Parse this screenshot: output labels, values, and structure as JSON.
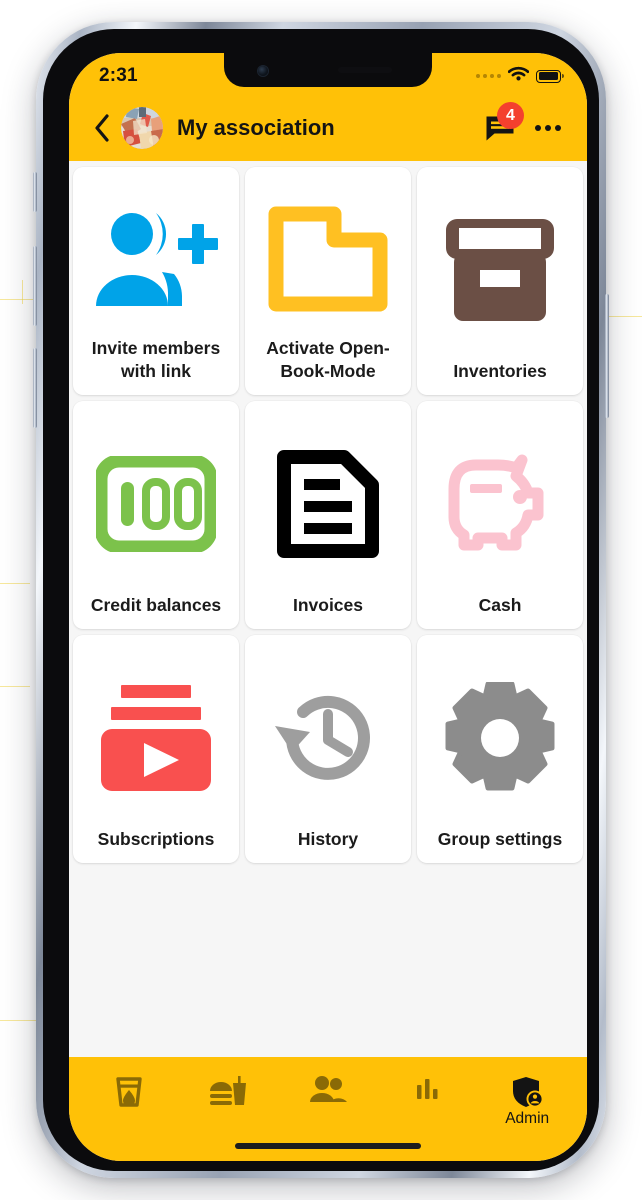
{
  "colors": {
    "brand_yellow": "#FFC107",
    "badge_red": "#F4402E",
    "content_bg": "#f6f6f6",
    "tile_bg": "#ffffff",
    "invite_blue": "#00A3E8",
    "openbook_yellow": "#FFC022",
    "inventories_brown": "#6B4F45",
    "credit_green": "#7CC24B",
    "invoices_black": "#000000",
    "cash_pink": "#FBC3CF",
    "subscriptions_red": "#F9504F",
    "history_gray": "#9E9E9E",
    "settings_gray": "#8C8C8C",
    "nav_icon": "#8A6A06"
  },
  "statusbar": {
    "time": "2:31",
    "cellular_icon": "cellular-dots-icon",
    "wifi_icon": "wifi-icon",
    "battery_icon": "battery-full-icon"
  },
  "appbar": {
    "back_icon": "back-chevron-icon",
    "avatar_icon": "group-photo-avatar",
    "title": "My association",
    "chat_icon": "chat-bubble-icon",
    "chat_badge": "4",
    "more_icon": "more-options-icon"
  },
  "grid": {
    "tiles": [
      {
        "id": "invite-members-with-link",
        "label": "Invite members with link",
        "icon": "person-add-icon"
      },
      {
        "id": "activate-open-book-mode",
        "label": "Activate Open-Book-Mode",
        "icon": "open-folder-icon"
      },
      {
        "id": "inventories",
        "label": "Inventories",
        "icon": "archive-box-icon"
      },
      {
        "id": "credit-balances",
        "label": "Credit balances",
        "icon": "banknote-100-icon"
      },
      {
        "id": "invoices",
        "label": "Invoices",
        "icon": "document-lines-icon"
      },
      {
        "id": "cash",
        "label": "Cash",
        "icon": "piggy-bank-icon"
      },
      {
        "id": "subscriptions",
        "label": "Subscriptions",
        "icon": "video-play-stack-icon"
      },
      {
        "id": "history",
        "label": "History",
        "icon": "clock-rewind-icon"
      },
      {
        "id": "group-settings",
        "label": "Group settings",
        "icon": "gear-icon"
      }
    ]
  },
  "bottomnav": {
    "items": [
      {
        "id": "drinks",
        "label": "",
        "icon": "drink-glass-icon",
        "active": false
      },
      {
        "id": "food",
        "label": "",
        "icon": "fast-food-icon",
        "active": false
      },
      {
        "id": "members",
        "label": "",
        "icon": "people-icon",
        "active": false
      },
      {
        "id": "stats",
        "label": "",
        "icon": "bar-chart-icon",
        "active": false
      },
      {
        "id": "admin",
        "label": "Admin",
        "icon": "shield-admin-icon",
        "active": true
      }
    ]
  }
}
